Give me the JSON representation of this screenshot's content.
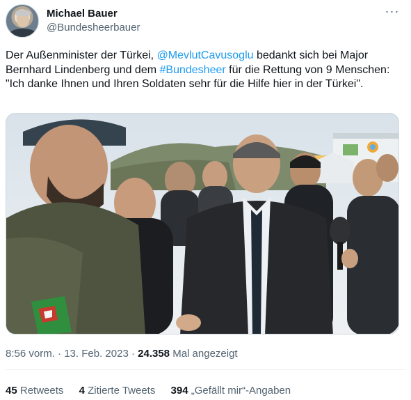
{
  "author": {
    "name": "Michael Bauer",
    "handle": "@Bundesheerbauer",
    "avatar_icon": "user-avatar"
  },
  "menu_icon": "more-horizontal-icon",
  "tweet": {
    "text_part1": "Der Außenminister der Türkei, ",
    "mention": "@MevlutCavusoglu",
    "text_part2": " bedankt sich bei Major Bernhard Lindenberg und dem ",
    "hashtag": "#Bundesheer",
    "text_part3": " für die Rettung von 9 Menschen: \"Ich danke Ihnen und Ihren Soldaten sehr für die Hilfe hier in der Türkei\"."
  },
  "photo": {
    "subject": "news-photo"
  },
  "meta": {
    "time": "8:56 vorm.",
    "separator1": " · ",
    "date": "13. Feb. 2023",
    "separator2": " · ",
    "views_count": "24.358",
    "views_label": " Mal angezeigt"
  },
  "stats": {
    "retweets_count": "45",
    "retweets_label": " Retweets",
    "quotes_count": "4",
    "quotes_label": " Zitierte Tweets",
    "likes_count": "394",
    "likes_label": " „Gefällt mir“-Angaben"
  },
  "colors": {
    "link": "#1d9bf0",
    "secondary_text": "#536471",
    "primary_text": "#0f1419"
  }
}
